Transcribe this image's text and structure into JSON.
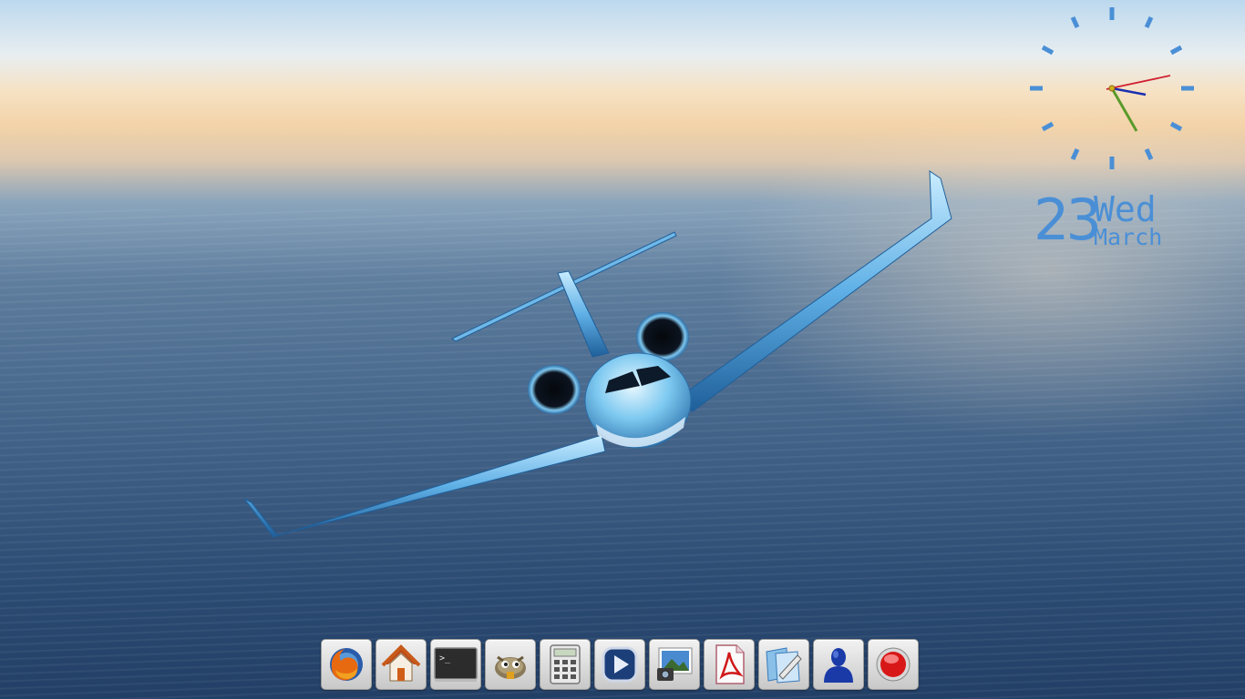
{
  "desktop": {
    "wallpaper": "business-jet-over-ocean",
    "accent_color": "#4a8fd6"
  },
  "clock_widget": {
    "day": "23",
    "weekday": "Wed",
    "month": "March",
    "hand_colors": {
      "hour": "#1b2fb0",
      "minute": "#5a9a2a",
      "second": "#d02030"
    }
  },
  "dock": {
    "items": [
      {
        "name": "firefox",
        "icon": "firefox-icon"
      },
      {
        "name": "home-folder",
        "icon": "home-icon"
      },
      {
        "name": "terminal",
        "icon": "terminal-icon"
      },
      {
        "name": "gimp",
        "icon": "gimp-icon"
      },
      {
        "name": "calculator",
        "icon": "calculator-icon"
      },
      {
        "name": "media-player",
        "icon": "play-icon"
      },
      {
        "name": "image-viewer",
        "icon": "photo-icon"
      },
      {
        "name": "pdf-reader",
        "icon": "pdf-icon"
      },
      {
        "name": "text-editor",
        "icon": "editor-icon"
      },
      {
        "name": "user-accounts",
        "icon": "user-icon"
      },
      {
        "name": "shutdown",
        "icon": "power-icon"
      }
    ],
    "terminal_prompt": ">_"
  }
}
